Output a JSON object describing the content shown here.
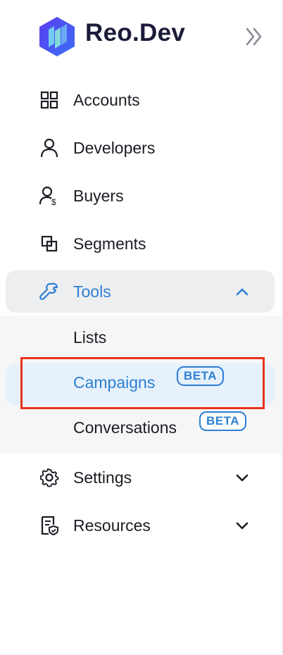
{
  "brand": {
    "name": "Reo.Dev"
  },
  "colors": {
    "accent": "#2d7fd3",
    "active_bg": "#e6f1fc",
    "tools_bg": "#edeef0",
    "highlight": "#e8321c",
    "brand_text": "#1b1b3a"
  },
  "nav": {
    "items": [
      {
        "label": "Accounts",
        "icon": "grid-icon"
      },
      {
        "label": "Developers",
        "icon": "user-icon"
      },
      {
        "label": "Buyers",
        "icon": "user-dollar-icon"
      },
      {
        "label": "Segments",
        "icon": "segments-icon"
      },
      {
        "label": "Tools",
        "icon": "wrench-icon",
        "expanded": true
      },
      {
        "label": "Settings",
        "icon": "gear-icon"
      },
      {
        "label": "Resources",
        "icon": "resources-icon"
      }
    ],
    "tools_sub": [
      {
        "label": "Lists"
      },
      {
        "label": "Campaigns",
        "badge": "BETA",
        "active": true
      },
      {
        "label": "Conversations",
        "badge": "BETA"
      }
    ]
  }
}
